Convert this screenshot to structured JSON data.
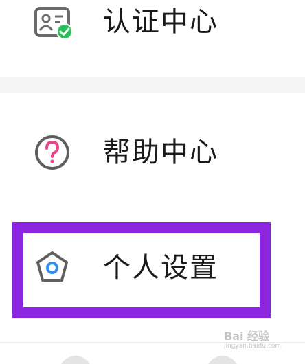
{
  "menu": {
    "items": [
      {
        "label": "认证中心",
        "icon": "certificate-icon"
      },
      {
        "label": "帮助中心",
        "icon": "help-question-icon"
      },
      {
        "label": "个人设置",
        "icon": "settings-pentagon-icon"
      }
    ]
  },
  "colors": {
    "highlight": "#8b25e0",
    "check_green": "#2bbf59",
    "help_pink": "#e8438f",
    "settings_blue": "#2f8cf0"
  },
  "watermark": {
    "main": "Bai 经验",
    "sub": "jingyan.baidu.com"
  }
}
